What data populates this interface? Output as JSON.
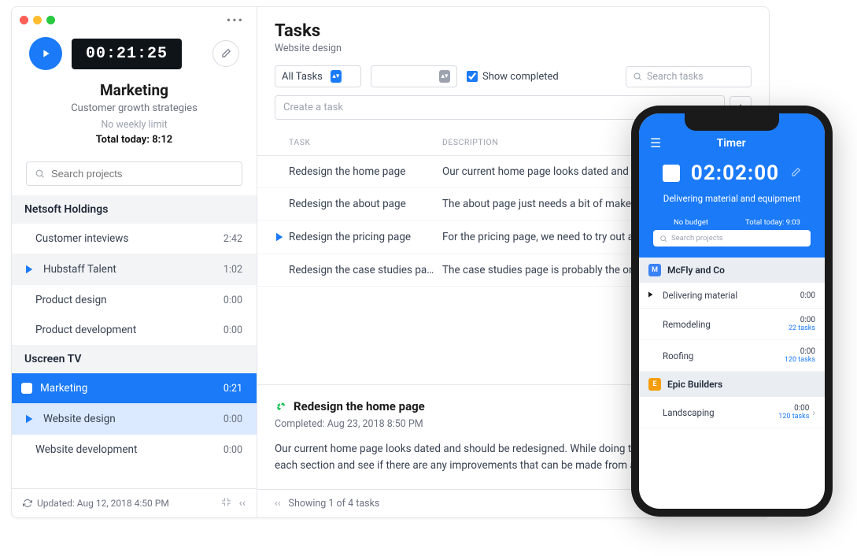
{
  "sidebar": {
    "timer": "00:21:25",
    "project_title": "Marketing",
    "project_sub": "Customer growth strategies",
    "weekly_limit": "No weekly limit",
    "total_today": "Total today: 8:12",
    "search_placeholder": "Search projects",
    "groups": [
      {
        "name": "Netsoft Holdings",
        "items": [
          {
            "label": "Customer inteviews",
            "time": "2:42",
            "play": false
          },
          {
            "label": "Hubstaff Talent",
            "time": "1:02",
            "play": true,
            "hub": true
          },
          {
            "label": "Product design",
            "time": "0:00",
            "play": false
          },
          {
            "label": "Product development",
            "time": "0:00",
            "play": false
          }
        ]
      },
      {
        "name": "Uscreen TV",
        "items": [
          {
            "label": "Marketing",
            "time": "0:21",
            "play": false,
            "active": true,
            "square": true
          },
          {
            "label": "Website design",
            "time": "0:00",
            "play": true,
            "selected": true
          },
          {
            "label": "Website development",
            "time": "0:00",
            "play": false
          }
        ]
      }
    ],
    "footer": "Updated: Aug 12, 2018 4:50 PM"
  },
  "main": {
    "title": "Tasks",
    "subtitle": "Website design",
    "filter": "All Tasks",
    "show_completed": "Show completed",
    "search_placeholder": "Search tasks",
    "create_placeholder": "Create a task",
    "col_task": "TASK",
    "col_desc": "DESCRIPTION",
    "rows": [
      {
        "name": "Redesign the home page",
        "desc": "Our current home page looks dated and should...",
        "play": false
      },
      {
        "name": "Redesign the about page",
        "desc": "The about page just needs a bit of makeup, bec...",
        "play": false
      },
      {
        "name": "Redesign the pricing page",
        "desc": "For the pricing page, we need to try out a differe...",
        "play": true
      },
      {
        "name": "Redesign the case studies pa...",
        "desc": "The case studies page is probably the one that ...",
        "play": false
      }
    ],
    "detail": {
      "title": "Redesign the home page",
      "completed": "Completed: Aug 23, 2018 8:50 PM",
      "body": "Our current home page looks dated and should be redesigned. While doing this we can also look at each section and see if there are any improvements that can be made from a marketing point..."
    },
    "footer": "Showing 1 of 4 tasks"
  },
  "phone": {
    "title": "Timer",
    "timer": "02:02:00",
    "sub": "Delivering material and equipment",
    "budget": "No budget",
    "today": "Total today: 9:03",
    "search_placeholder": "Search projects",
    "groups": [
      {
        "name": "McFly and Co",
        "badge_color": "#3b82f6",
        "badge_letter": "M",
        "items": [
          {
            "label": "Delivering material",
            "time": "0:00",
            "tasks": "",
            "play": true
          },
          {
            "label": "Remodeling",
            "time": "0:00",
            "tasks": "22 tasks",
            "play": false
          },
          {
            "label": "Roofing",
            "time": "0:00",
            "tasks": "120 tasks",
            "play": false
          }
        ]
      },
      {
        "name": "Epic Builders",
        "badge_color": "#f59e0b",
        "badge_letter": "E",
        "items": [
          {
            "label": "Landscaping",
            "time": "0:00",
            "tasks": "120 tasks",
            "play": false,
            "chev": true
          }
        ]
      }
    ]
  }
}
